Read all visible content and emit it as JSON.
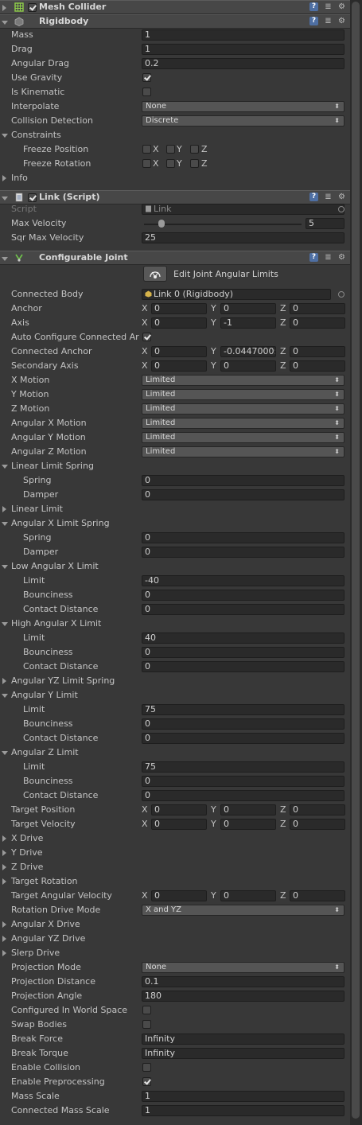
{
  "mesh_collider": {
    "title": "Mesh Collider",
    "enabled": true
  },
  "rigidbody": {
    "title": "Rigidbody",
    "mass": {
      "label": "Mass",
      "value": "1"
    },
    "drag": {
      "label": "Drag",
      "value": "1"
    },
    "angular_drag": {
      "label": "Angular Drag",
      "value": "0.2"
    },
    "use_gravity": {
      "label": "Use Gravity",
      "checked": true
    },
    "is_kinematic": {
      "label": "Is Kinematic",
      "checked": false
    },
    "interpolate": {
      "label": "Interpolate",
      "value": "None"
    },
    "collision_detection": {
      "label": "Collision Detection",
      "value": "Discrete"
    },
    "constraints": {
      "label": "Constraints"
    },
    "freeze_position": {
      "label": "Freeze Position",
      "x": "X",
      "y": "Y",
      "z": "Z"
    },
    "freeze_rotation": {
      "label": "Freeze Rotation",
      "x": "X",
      "y": "Y",
      "z": "Z"
    },
    "info": {
      "label": "Info"
    }
  },
  "link_script": {
    "title": "Link (Script)",
    "enabled": true,
    "script": {
      "label": "Script",
      "value": "Link"
    },
    "max_velocity": {
      "label": "Max Velocity",
      "value": "5",
      "fraction": 0.11
    },
    "sqr_max_velocity": {
      "label": "Sqr Max Velocity",
      "value": "25"
    }
  },
  "configurable_joint": {
    "title": "Configurable Joint",
    "edit_button_label": "Edit Joint Angular Limits",
    "connected_body": {
      "label": "Connected Body",
      "value": "Link 0 (Rigidbody)"
    },
    "anchor": {
      "label": "Anchor",
      "x": "0",
      "y": "0",
      "z": "0"
    },
    "axis": {
      "label": "Axis",
      "x": "0",
      "y": "-1",
      "z": "0"
    },
    "auto_configure": {
      "label": "Auto Configure Connected Ar",
      "checked": true
    },
    "connected_anchor": {
      "label": "Connected Anchor",
      "x": "0",
      "y": "-0.0447000:",
      "z": "0"
    },
    "secondary_axis": {
      "label": "Secondary Axis",
      "x": "0",
      "y": "0",
      "z": "0"
    },
    "x_motion": {
      "label": "X Motion",
      "value": "Limited"
    },
    "y_motion": {
      "label": "Y Motion",
      "value": "Limited"
    },
    "z_motion": {
      "label": "Z Motion",
      "value": "Limited"
    },
    "angular_x_motion": {
      "label": "Angular X Motion",
      "value": "Limited"
    },
    "angular_y_motion": {
      "label": "Angular Y Motion",
      "value": "Limited"
    },
    "angular_z_motion": {
      "label": "Angular Z Motion",
      "value": "Limited"
    },
    "linear_limit_spring": {
      "label": "Linear Limit Spring",
      "spring_label": "Spring",
      "spring": "0",
      "damper_label": "Damper",
      "damper": "0"
    },
    "linear_limit": {
      "label": "Linear Limit"
    },
    "angular_x_limit_spring": {
      "label": "Angular X Limit Spring",
      "spring_label": "Spring",
      "spring": "0",
      "damper_label": "Damper",
      "damper": "0"
    },
    "low_angular_x_limit": {
      "label": "Low Angular X Limit",
      "limit_label": "Limit",
      "limit": "-40",
      "bounciness_label": "Bounciness",
      "bounciness": "0",
      "contact_label": "Contact Distance",
      "contact": "0"
    },
    "high_angular_x_limit": {
      "label": "High Angular X Limit",
      "limit_label": "Limit",
      "limit": "40",
      "bounciness_label": "Bounciness",
      "bounciness": "0",
      "contact_label": "Contact Distance",
      "contact": "0"
    },
    "angular_yz_limit_spring": {
      "label": "Angular YZ Limit Spring"
    },
    "angular_y_limit": {
      "label": "Angular Y Limit",
      "limit_label": "Limit",
      "limit": "75",
      "bounciness_label": "Bounciness",
      "bounciness": "0",
      "contact_label": "Contact Distance",
      "contact": "0"
    },
    "angular_z_limit": {
      "label": "Angular Z Limit",
      "limit_label": "Limit",
      "limit": "75",
      "bounciness_label": "Bounciness",
      "bounciness": "0",
      "contact_label": "Contact Distance",
      "contact": "0"
    },
    "target_position": {
      "label": "Target Position",
      "x": "0",
      "y": "0",
      "z": "0"
    },
    "target_velocity": {
      "label": "Target Velocity",
      "x": "0",
      "y": "0",
      "z": "0"
    },
    "x_drive": {
      "label": "X Drive"
    },
    "y_drive": {
      "label": "Y Drive"
    },
    "z_drive": {
      "label": "Z Drive"
    },
    "target_rotation": {
      "label": "Target Rotation"
    },
    "target_angular_velocity": {
      "label": "Target Angular Velocity",
      "x": "0",
      "y": "0",
      "z": "0"
    },
    "rotation_drive_mode": {
      "label": "Rotation Drive Mode",
      "value": "X and YZ"
    },
    "angular_x_drive": {
      "label": "Angular X Drive"
    },
    "angular_yz_drive": {
      "label": "Angular YZ Drive"
    },
    "slerp_drive": {
      "label": "Slerp Drive"
    },
    "projection_mode": {
      "label": "Projection Mode",
      "value": "None"
    },
    "projection_distance": {
      "label": "Projection Distance",
      "value": "0.1"
    },
    "projection_angle": {
      "label": "Projection Angle",
      "value": "180"
    },
    "configured_in_world_space": {
      "label": "Configured In World Space",
      "checked": false
    },
    "swap_bodies": {
      "label": "Swap Bodies",
      "checked": false
    },
    "break_force": {
      "label": "Break Force",
      "value": "Infinity"
    },
    "break_torque": {
      "label": "Break Torque",
      "value": "Infinity"
    },
    "enable_collision": {
      "label": "Enable Collision",
      "checked": false
    },
    "enable_preprocessing": {
      "label": "Enable Preprocessing",
      "checked": true
    },
    "mass_scale": {
      "label": "Mass Scale",
      "value": "1"
    },
    "connected_mass_scale": {
      "label": "Connected Mass Scale",
      "value": "1"
    }
  },
  "axis_letters": {
    "x": "X",
    "y": "Y",
    "z": "Z"
  },
  "icons": {
    "help": "help-icon",
    "preset": "preset-icon",
    "settings": "gear-icon",
    "fold": "foldout-arrow-icon"
  }
}
